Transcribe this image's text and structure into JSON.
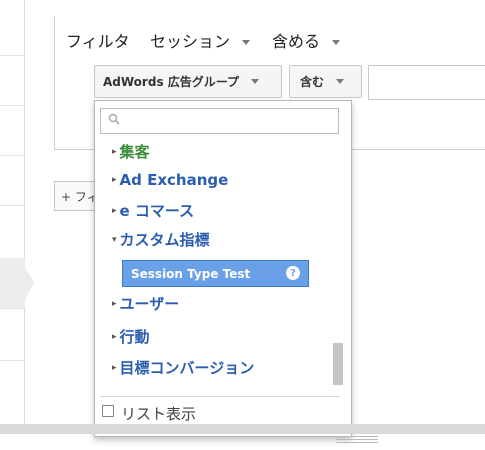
{
  "filter": {
    "label": "フィルタ",
    "scope_label": "セッション",
    "mode_label": "含める",
    "dimension_button": "AdWords 広告グループ",
    "match_button": "含む",
    "value": ""
  },
  "add_filter_label": "+ フィルタを追加",
  "dropdown": {
    "search_placeholder": "",
    "items": [
      {
        "label": "集客",
        "arrow": "▸",
        "color": "#3a8d3a"
      },
      {
        "label": "Ad Exchange",
        "arrow": "▸",
        "color": "#2a5db0"
      },
      {
        "label": "e コマース",
        "arrow": "▸",
        "color": "#2a5db0"
      },
      {
        "label": "カスタム指標",
        "arrow": "▾",
        "color": "#2a5db0"
      },
      {
        "label": "ユーザー",
        "arrow": "▸",
        "color": "#2a5db0"
      },
      {
        "label": "行動",
        "arrow": "▸",
        "color": "#2a5db0"
      },
      {
        "label": "目標コンバージョン",
        "arrow": "▸",
        "color": "#2a5db0"
      }
    ],
    "selected_item": "Session Type Test",
    "help_glyph": "?",
    "list_view_label": "リスト表示"
  },
  "icons": {
    "search": "search-icon",
    "help": "help-icon",
    "caret": "chevron-down-icon"
  }
}
